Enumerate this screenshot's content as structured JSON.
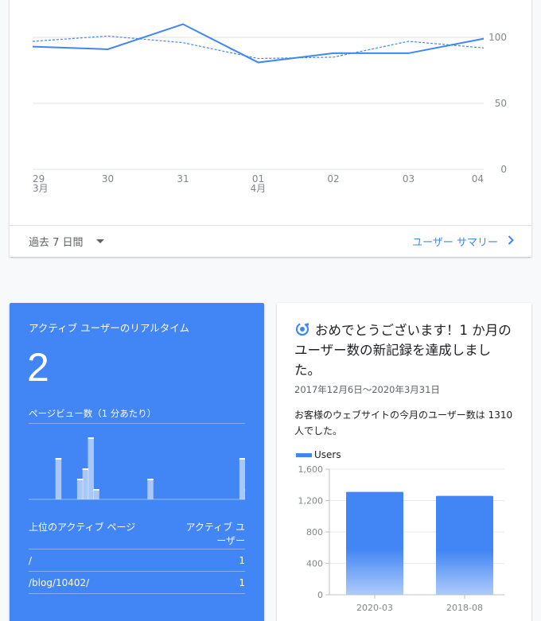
{
  "overview": {
    "range_label": "過去 7 日間",
    "summary_link": "ユーザー サマリー",
    "chart_data": {
      "type": "line",
      "x": [
        "29",
        "30",
        "31",
        "01",
        "02",
        "03",
        "04"
      ],
      "x_sublabels": [
        "3月",
        "",
        "",
        "4月",
        "",
        "",
        ""
      ],
      "series": [
        {
          "values": [
            93,
            91,
            110,
            81,
            88,
            88,
            99
          ],
          "style": "solid"
        },
        {
          "values": [
            97,
            101,
            96,
            84,
            85,
            97,
            92
          ],
          "style": "dashed"
        }
      ],
      "y_ticks": [
        100,
        50,
        0
      ],
      "ylim": [
        0,
        110
      ],
      "color": "#4285f4"
    }
  },
  "realtime": {
    "title": "アクティブ ユーザーのリアルタイム",
    "count": "2",
    "pageviews_label": "ページビュー数（1 分あたり）",
    "bars": [
      0,
      0,
      0,
      0,
      4,
      0,
      0,
      0,
      2,
      3,
      6,
      1,
      0,
      0,
      0,
      0,
      0,
      0,
      0,
      0,
      0,
      2,
      0,
      0,
      0,
      0,
      0,
      0,
      0,
      0,
      0,
      0,
      0,
      0,
      0,
      0,
      0,
      0,
      4,
      1,
      1
    ],
    "table_header": {
      "page": "上位のアクティブ ページ",
      "users": "アクティブ ユーザー"
    },
    "rows": [
      {
        "page": "/",
        "users": "1"
      },
      {
        "page": "/blog/10402/",
        "users": "1"
      }
    ],
    "bg_color": "#4285f4"
  },
  "record": {
    "title": "おめでとうございます！1 か月のユーザー数の新記録を達成しました。",
    "period": "2017年12月6日～2020年3月31日",
    "message": "お客様のウェブサイトの今月のユーザー数は 1310 人でした。",
    "icon": "insights-icon",
    "chart_data": {
      "type": "bar",
      "legend": "Users",
      "categories": [
        "2020-03",
        "2018-08"
      ],
      "values": [
        1310,
        1260
      ],
      "y_ticks": [
        "1,600",
        "1,200",
        "800",
        "400",
        "0"
      ],
      "ylim": [
        0,
        1600
      ]
    }
  }
}
